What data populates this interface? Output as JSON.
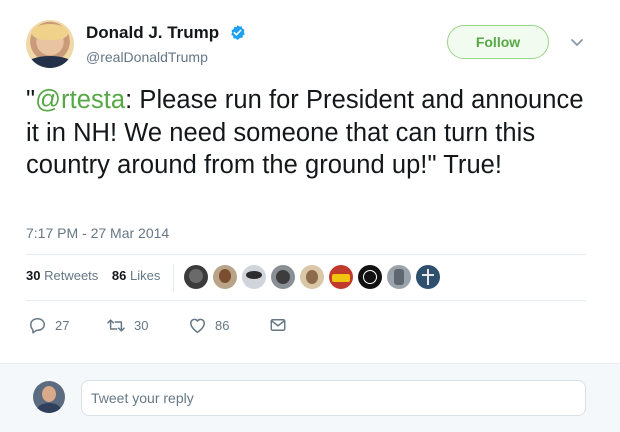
{
  "tweet": {
    "author": {
      "name": "Donald J. Trump",
      "handle": "@realDonaldTrump",
      "verified": true
    },
    "follow_label": "Follow",
    "text": {
      "quote_open": "\"",
      "mention": "@rtesta",
      "body": ": Please run for President and announce it in NH! We need someone that can turn this country around from the ground up!\" True!"
    },
    "timestamp": "7:17 PM - 27 Mar 2014",
    "stats": {
      "retweets_count": "30",
      "retweets_label": "Retweets",
      "likes_count": "86",
      "likes_label": "Likes"
    },
    "likers_shown": 10,
    "actions": {
      "reply_count": "27",
      "retweet_count": "30",
      "like_count": "86"
    }
  },
  "reply_box": {
    "placeholder": "Tweet your reply"
  },
  "colors": {
    "accent_green": "#55a845",
    "verified_blue": "#1da1f2",
    "text": "#14171a",
    "muted": "#657786"
  },
  "icons": {
    "verified": "verified-badge-icon",
    "menu": "chevron-down-icon",
    "reply": "reply-icon",
    "retweet": "retweet-icon",
    "like": "heart-icon",
    "message": "envelope-icon"
  }
}
